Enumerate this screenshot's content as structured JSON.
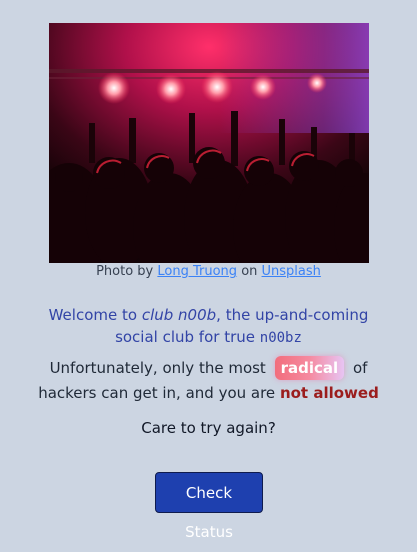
{
  "photo": {
    "alt": "Concert crowd with red stage lights"
  },
  "caption": {
    "prefix": "Photo by",
    "author": "Long Truong",
    "middle": "on",
    "source": "Unsplash"
  },
  "welcome": {
    "part1": "Welcome to ",
    "club": "club n00b",
    "part2": ", the up-and-coming social club for true ",
    "code": "n00bz"
  },
  "message": {
    "part1": "Unfortunately, only the most",
    "badge": "radical",
    "part2": "of hackers can get in, and you are",
    "emphasis": "not allowed"
  },
  "prompt": "Care to try again?",
  "button": {
    "label": "Check Status"
  },
  "colors": {
    "background": "#ccd5e2",
    "accent_text": "#3244a6",
    "button": "#1e40af",
    "danger": "#9b1d1d",
    "link": "#3b82f6"
  }
}
